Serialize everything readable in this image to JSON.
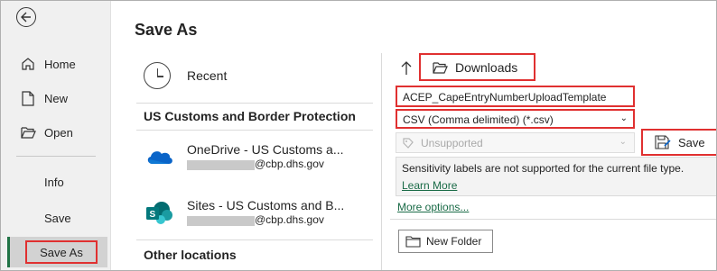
{
  "nav": {
    "back_icon": "back-arrow-icon",
    "items": [
      {
        "label": "Home",
        "icon": "home-icon"
      },
      {
        "label": "New",
        "icon": "new-document-icon"
      },
      {
        "label": "Open",
        "icon": "open-folder-icon"
      },
      {
        "label": "Info"
      },
      {
        "label": "Save"
      },
      {
        "label": "Save As"
      }
    ]
  },
  "main": {
    "title": "Save As",
    "recent_label": "Recent",
    "section_org": "US Customs and Border Protection",
    "locations": [
      {
        "name": "OneDrive - US Customs a...",
        "email": "@cbp.dhs.gov",
        "icon": "onedrive-cloud-icon"
      },
      {
        "name": "Sites - US Customs and B...",
        "email": "@cbp.dhs.gov",
        "icon": "sharepoint-icon"
      }
    ],
    "section_other": "Other locations"
  },
  "right": {
    "folder": "Downloads",
    "filename": "ACEP_CapeEntryNumberUploadTemplate",
    "filetype": "CSV (Comma delimited) (*.csv)",
    "sensitivity": "Unsupported",
    "save_label": "Save",
    "info_text": "Sensitivity labels are not supported for the current file type.",
    "learn_more": "Learn More",
    "more_options": "More options...",
    "new_folder": "New Folder"
  },
  "colors": {
    "highlight_border": "#e03030",
    "accent_green": "#217346",
    "link_green": "#1a6b47",
    "onedrive_blue": "#0a64c8",
    "sharepoint_teal": "#038387"
  }
}
